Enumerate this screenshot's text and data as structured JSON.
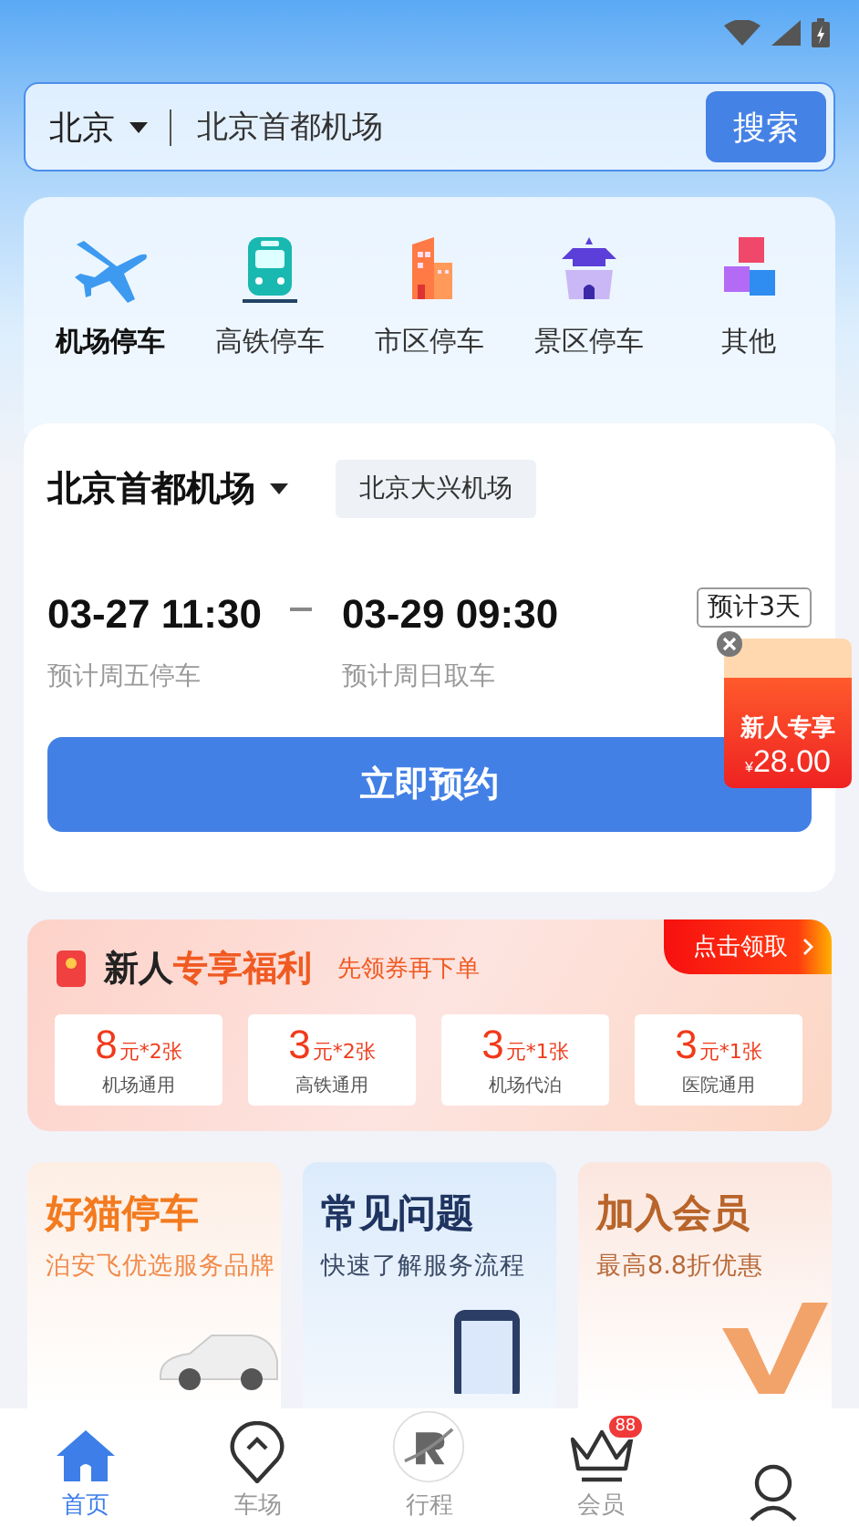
{
  "search": {
    "city": "北京",
    "value": "北京首都机场",
    "button": "搜索"
  },
  "categories": [
    {
      "label": "机场停车",
      "kind": "plane",
      "selected": true
    },
    {
      "label": "高铁停车",
      "kind": "train",
      "selected": false
    },
    {
      "label": "市区停车",
      "kind": "building",
      "selected": false
    },
    {
      "label": "景区停车",
      "kind": "pavilion",
      "selected": false
    },
    {
      "label": "其他",
      "kind": "cubes",
      "selected": false
    }
  ],
  "booking": {
    "airports": [
      {
        "label": "北京首都机场",
        "selected": true
      },
      {
        "label": "北京大兴机场",
        "selected": false
      }
    ],
    "start": {
      "time": "03-27 11:30",
      "hint": "预计周五停车"
    },
    "end": {
      "time": "03-29 09:30",
      "hint": "预计周日取车"
    },
    "duration": "预计3天",
    "button": "立即预约"
  },
  "promo": {
    "title": "新人专享",
    "currency": "¥",
    "amount": "28.00"
  },
  "welfare": {
    "title": "新人",
    "title_highlight": "专享福利",
    "subtitle": "先领券再下单",
    "action": "点击领取",
    "coupons": [
      {
        "amount": "8",
        "unit": "元*2张",
        "scope": "机场通用"
      },
      {
        "amount": "3",
        "unit": "元*2张",
        "scope": "高铁通用"
      },
      {
        "amount": "3",
        "unit": "元*1张",
        "scope": "机场代泊"
      },
      {
        "amount": "3",
        "unit": "元*1张",
        "scope": "医院通用"
      }
    ]
  },
  "cards": [
    {
      "kind": "parking",
      "title": "好猫停车",
      "subtitle": "泊安飞优选服务品牌"
    },
    {
      "kind": "faq",
      "title": "常见问题",
      "subtitle": "快速了解服务流程"
    },
    {
      "kind": "member",
      "title": "加入会员",
      "subtitle": "最高8.8折优惠"
    }
  ],
  "nav": [
    {
      "kind": "home",
      "label": "首页",
      "selected": true
    },
    {
      "kind": "pin",
      "label": "车场",
      "selected": false
    },
    {
      "kind": "logo",
      "label": "行程",
      "selected": false
    },
    {
      "kind": "crown",
      "label": "会员",
      "selected": false,
      "badge": "88"
    },
    {
      "kind": "person",
      "selected": false
    }
  ]
}
